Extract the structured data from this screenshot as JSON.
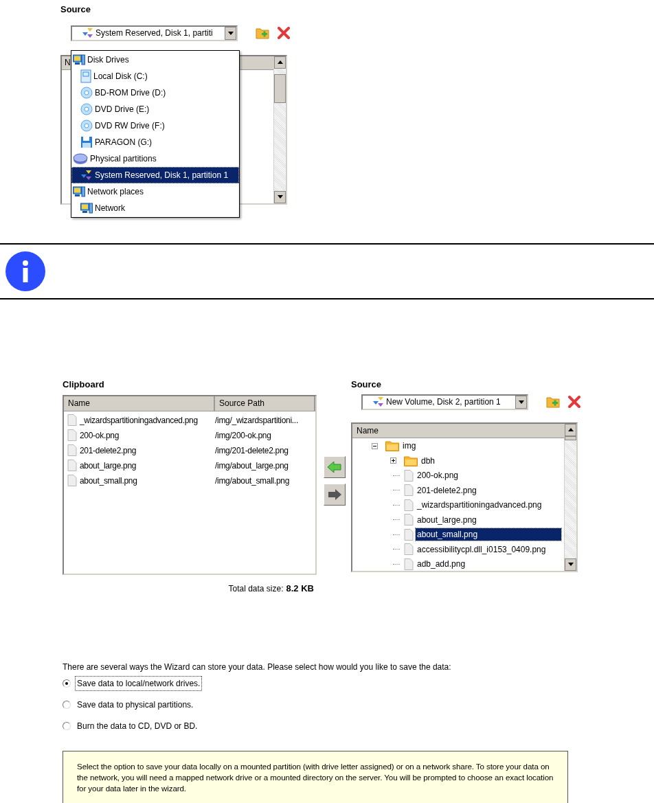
{
  "top_source": {
    "heading": "Source",
    "combo": {
      "value": "System Reserved, Disk 1, partiti"
    },
    "list_header": "N",
    "dropdown": {
      "items": [
        {
          "label": "Disk Drives",
          "kind": "computer",
          "selected": false,
          "children": [
            {
              "label": "Local Disk (C:)",
              "kind": "hdd",
              "selected": false
            },
            {
              "label": "BD-ROM Drive (D:)",
              "kind": "disc",
              "selected": false
            },
            {
              "label": "DVD Drive (E:)",
              "kind": "disc",
              "selected": false
            },
            {
              "label": "DVD RW Drive (F:)",
              "kind": "disc",
              "selected": false
            },
            {
              "label": "PARAGON (G:)",
              "kind": "floppy",
              "selected": false
            }
          ]
        },
        {
          "label": "Physical partitions",
          "kind": "disk",
          "selected": false,
          "children": [
            {
              "label": "System Reserved, Disk 1, partition 1",
              "kind": "partition",
              "selected": true
            }
          ]
        },
        {
          "label": "Network places",
          "kind": "computer",
          "selected": false,
          "children": [
            {
              "label": "Network",
              "kind": "computer",
              "selected": false
            }
          ]
        }
      ]
    }
  },
  "clipboard": {
    "heading": "Clipboard",
    "columns": [
      "Name",
      "Source Path"
    ],
    "rows": [
      {
        "name": "_wizardspartitioningadvanced.png",
        "path": "/img/_wizardspartitioni..."
      },
      {
        "name": "200-ok.png",
        "path": "/img/200-ok.png"
      },
      {
        "name": "201-delete2.png",
        "path": "/img/201-delete2.png"
      },
      {
        "name": "about_large.png",
        "path": "/img/about_large.png"
      },
      {
        "name": "about_small.png",
        "path": "/img/about_small.png"
      }
    ],
    "total_label": "Total data size:",
    "total_value": "8.2 KB"
  },
  "source": {
    "heading": "Source",
    "combo": {
      "value": "New Volume, Disk 2, partition 1"
    },
    "column": "Name",
    "tree": [
      {
        "label": "img",
        "kind": "folder",
        "expanded": true,
        "selected": false,
        "children": [
          {
            "label": "dbh",
            "kind": "folder",
            "expanded": false,
            "selected": false
          },
          {
            "label": "200-ok.png",
            "kind": "file",
            "selected": false
          },
          {
            "label": "201-delete2.png",
            "kind": "file",
            "selected": false
          },
          {
            "label": "_wizardspartitioningadvanced.png",
            "kind": "file",
            "selected": false
          },
          {
            "label": "about_large.png",
            "kind": "file",
            "selected": false
          },
          {
            "label": "about_small.png",
            "kind": "file",
            "selected": true
          },
          {
            "label": "accessibilitycpl.dll_i0153_0409.png",
            "kind": "file",
            "selected": false
          },
          {
            "label": "adb_add.png",
            "kind": "file",
            "selected": false
          }
        ]
      }
    ]
  },
  "storage": {
    "prompt": "There are several ways the Wizard can store your data. Please select how would you like to save the data:",
    "options": [
      {
        "label": "Save data to local/network drives.",
        "selected": true
      },
      {
        "label": "Save data to physical partitions.",
        "selected": false
      },
      {
        "label": "Burn the data to CD, DVD or BD.",
        "selected": false
      }
    ],
    "hint": "Select the option to save your data locally on a mounted partition (with drive letter assigned) or on a network share. To store your data on the network, you will need a mapped network drive or a mounted directory on the server. You will be prompted to choose an exact location for your data later in the wizard."
  }
}
